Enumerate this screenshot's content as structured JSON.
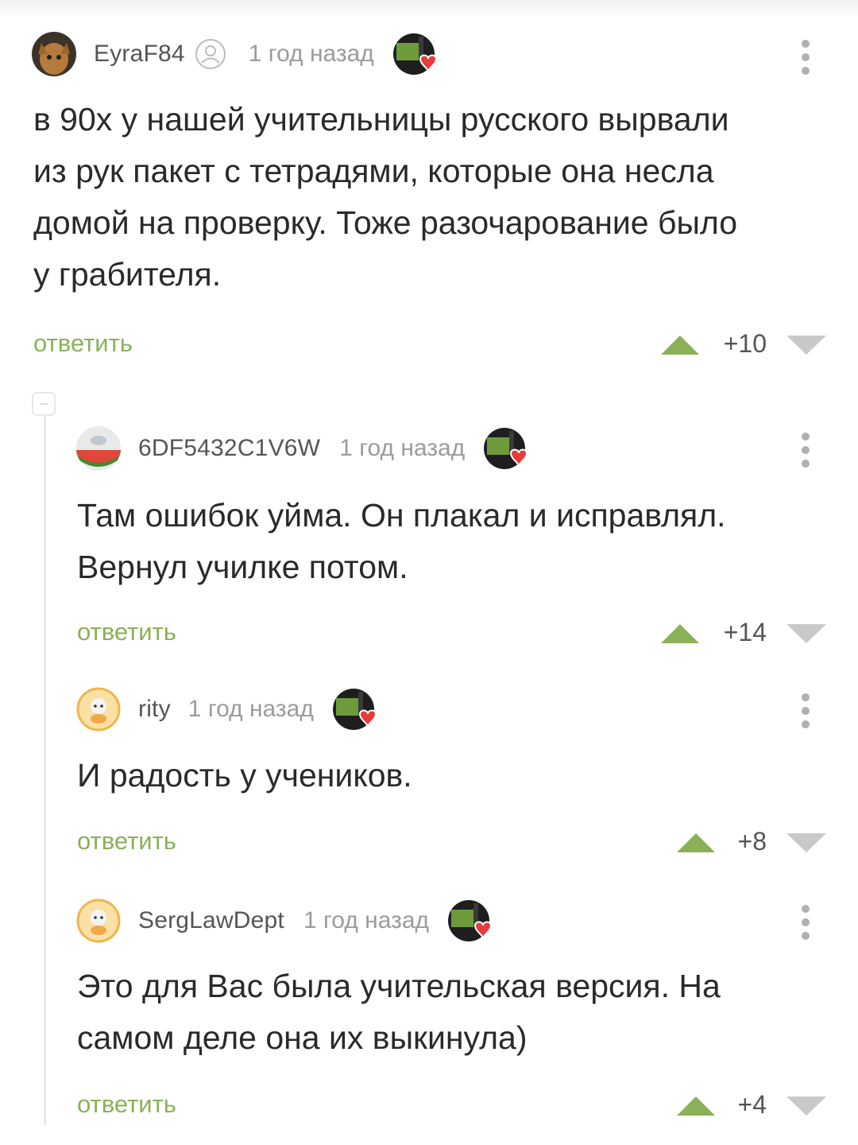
{
  "comments": [
    {
      "username": "EyraF84",
      "time": "1 год назад",
      "avatar_icon": "cat-avatar-icon",
      "has_verified_icon": true,
      "text_lines": [
        "в 90х у нашей учительницы русского вырвали",
        "из рук пакет с тетрадями, которые она несла",
        "домой на проверку. Тоже разочарование было",
        "у грабителя."
      ],
      "reply_label": "ответить",
      "score": "+10"
    },
    {
      "username": "6DF5432C1V6W",
      "time": "1 год назад",
      "avatar_icon": "watermelon-avatar-icon",
      "text_lines": [
        "Там ошибок уйма. Он плакал и исправлял.",
        "Вернул училке потом."
      ],
      "reply_label": "ответить",
      "score": "+14"
    },
    {
      "username": "rity",
      "time": "1 год назад",
      "avatar_icon": "default-avatar-icon",
      "text_lines": [
        "И радость у учеников."
      ],
      "reply_label": "ответить",
      "score": "+8"
    },
    {
      "username": "SergLawDept",
      "time": "1 год назад",
      "avatar_icon": "default-avatar-icon",
      "text_lines": [
        "Это для Вас была учительская версия. На",
        "самом деле она их выкинула)"
      ],
      "reply_label": "ответить",
      "score": "+4"
    }
  ],
  "colors": {
    "accent_green": "#8ab157",
    "text": "#2a2a2a",
    "username": "#555555",
    "muted": "#9b9b9b",
    "downvote": "#c9c9c9"
  }
}
